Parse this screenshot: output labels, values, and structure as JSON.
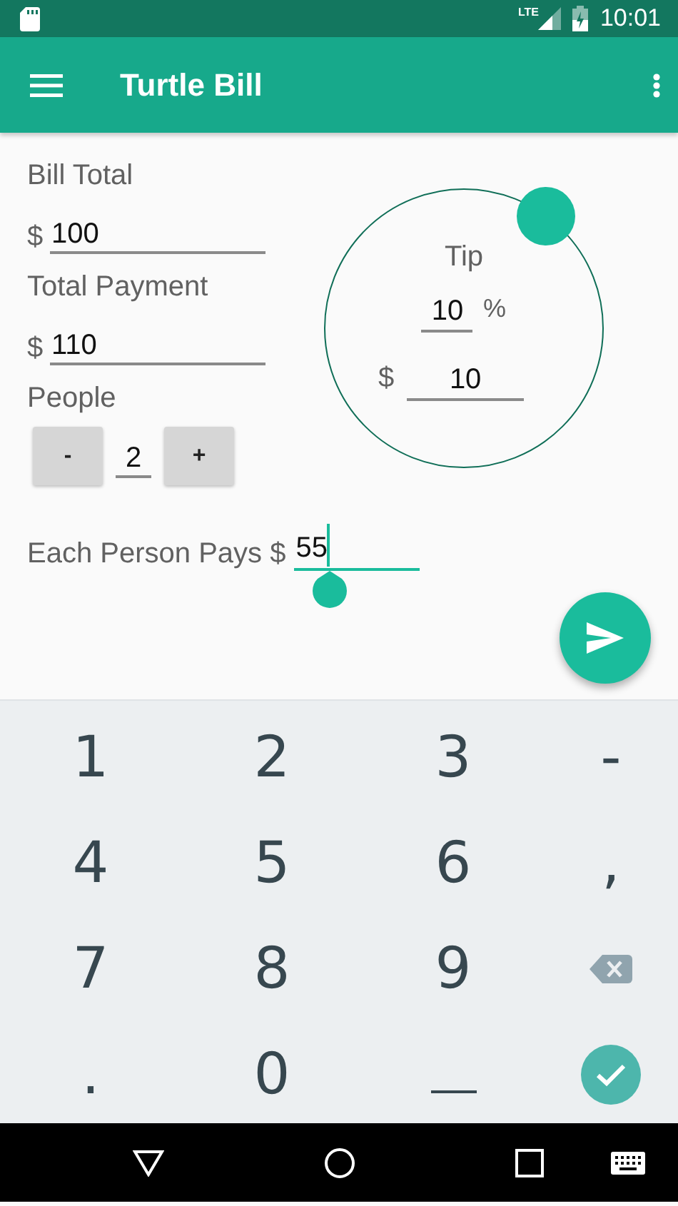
{
  "status_bar": {
    "network": "LTE",
    "time": "10:01"
  },
  "app_bar": {
    "title": "Turtle Bill"
  },
  "form": {
    "bill_total": {
      "label": "Bill Total",
      "currency": "$",
      "value": "100"
    },
    "total_payment": {
      "label": "Total Payment",
      "currency": "$",
      "value": "110"
    },
    "people": {
      "label": "People",
      "decrement": "-",
      "value": "2",
      "increment": "+"
    },
    "each_person_pays": {
      "label": "Each Person Pays $",
      "value": "55",
      "focused": true
    }
  },
  "tip": {
    "label": "Tip",
    "percent": "10",
    "percent_sign": "%",
    "currency": "$",
    "amount": "10"
  },
  "keyboard": {
    "keys": [
      {
        "kind": "char",
        "label": "1"
      },
      {
        "kind": "char",
        "label": "2"
      },
      {
        "kind": "char",
        "label": "3"
      },
      {
        "kind": "char",
        "label": "-"
      },
      {
        "kind": "char",
        "label": "4"
      },
      {
        "kind": "char",
        "label": "5"
      },
      {
        "kind": "char",
        "label": "6"
      },
      {
        "kind": "char",
        "label": ","
      },
      {
        "kind": "char",
        "label": "7"
      },
      {
        "kind": "char",
        "label": "8"
      },
      {
        "kind": "char",
        "label": "9"
      },
      {
        "kind": "backspace"
      },
      {
        "kind": "char",
        "label": "."
      },
      {
        "kind": "char",
        "label": "0"
      },
      {
        "kind": "space"
      },
      {
        "kind": "done"
      }
    ]
  }
}
